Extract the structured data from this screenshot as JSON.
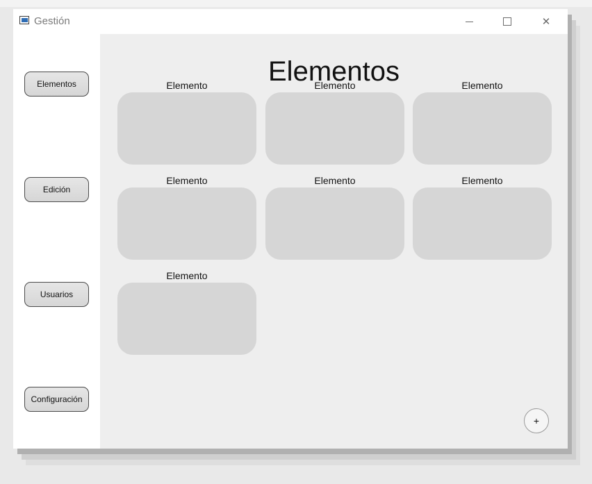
{
  "window": {
    "title": "Gestión",
    "controls": {
      "minimize": "minimize-icon",
      "maximize": "maximize-icon",
      "close": "close-icon"
    }
  },
  "sidebar": {
    "items": [
      {
        "label": "Elementos"
      },
      {
        "label": "Edición"
      },
      {
        "label": "Usuarios"
      },
      {
        "label": "Configuración"
      }
    ]
  },
  "main": {
    "title": "Elementos",
    "cards": [
      {
        "label": "Elemento"
      },
      {
        "label": "Elemento"
      },
      {
        "label": "Elemento"
      },
      {
        "label": "Elemento"
      },
      {
        "label": "Elemento"
      },
      {
        "label": "Elemento"
      },
      {
        "label": "Elemento"
      }
    ],
    "add_label": "+"
  },
  "colors": {
    "content_bg": "#eeeeee",
    "card_bg": "#d6d6d6",
    "button_bg": "#dcdcdc"
  }
}
